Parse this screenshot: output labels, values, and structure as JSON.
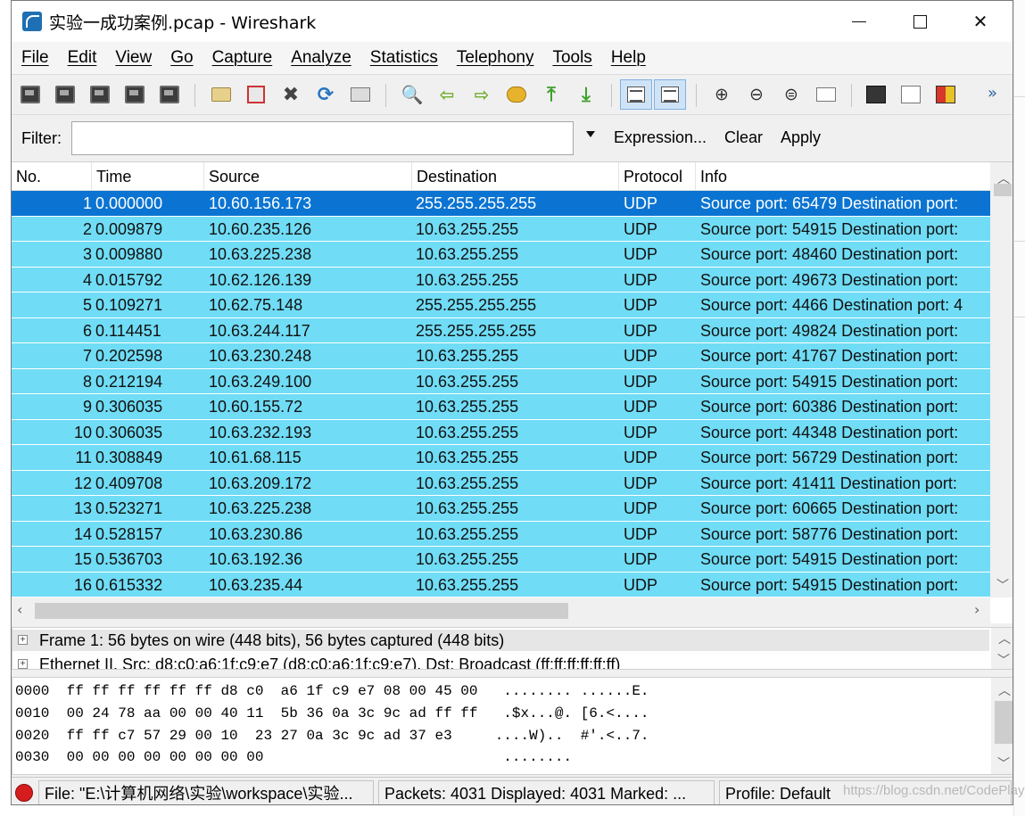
{
  "window": {
    "title": "实验一成功案例.pcap - Wireshark",
    "controls": {
      "minimize": "",
      "maximize": "",
      "close": "✕"
    }
  },
  "menu": [
    "File",
    "Edit",
    "View",
    "Go",
    "Capture",
    "Analyze",
    "Statistics",
    "Telephony",
    "Tools",
    "Help"
  ],
  "filter": {
    "label": "Filter:",
    "value": "",
    "expression": "Expression...",
    "clear": "Clear",
    "apply": "Apply"
  },
  "columns": [
    "No.",
    "Time",
    "Source",
    "Destination",
    "Protocol",
    "Info"
  ],
  "packets": [
    {
      "no": "1",
      "time": "0.000000",
      "src": "10.60.156.173",
      "dst": "255.255.255.255",
      "proto": "UDP",
      "info": "Source port: 65479  Destination port:"
    },
    {
      "no": "2",
      "time": "0.009879",
      "src": "10.60.235.126",
      "dst": "10.63.255.255",
      "proto": "UDP",
      "info": "Source port: 54915  Destination port:"
    },
    {
      "no": "3",
      "time": "0.009880",
      "src": "10.63.225.238",
      "dst": "10.63.255.255",
      "proto": "UDP",
      "info": "Source port: 48460  Destination port:"
    },
    {
      "no": "4",
      "time": "0.015792",
      "src": "10.62.126.139",
      "dst": "10.63.255.255",
      "proto": "UDP",
      "info": "Source port: 49673  Destination port:"
    },
    {
      "no": "5",
      "time": "0.109271",
      "src": "10.62.75.148",
      "dst": "255.255.255.255",
      "proto": "UDP",
      "info": "Source port: 4466  Destination port: 4"
    },
    {
      "no": "6",
      "time": "0.114451",
      "src": "10.63.244.117",
      "dst": "255.255.255.255",
      "proto": "UDP",
      "info": "Source port: 49824  Destination port:"
    },
    {
      "no": "7",
      "time": "0.202598",
      "src": "10.63.230.248",
      "dst": "10.63.255.255",
      "proto": "UDP",
      "info": "Source port: 41767  Destination port:"
    },
    {
      "no": "8",
      "time": "0.212194",
      "src": "10.63.249.100",
      "dst": "10.63.255.255",
      "proto": "UDP",
      "info": "Source port: 54915  Destination port:"
    },
    {
      "no": "9",
      "time": "0.306035",
      "src": "10.60.155.72",
      "dst": "10.63.255.255",
      "proto": "UDP",
      "info": "Source port: 60386  Destination port:"
    },
    {
      "no": "10",
      "time": "0.306035",
      "src": "10.63.232.193",
      "dst": "10.63.255.255",
      "proto": "UDP",
      "info": "Source port: 44348  Destination port:"
    },
    {
      "no": "11",
      "time": "0.308849",
      "src": "10.61.68.115",
      "dst": "10.63.255.255",
      "proto": "UDP",
      "info": "Source port: 56729  Destination port:"
    },
    {
      "no": "12",
      "time": "0.409708",
      "src": "10.63.209.172",
      "dst": "10.63.255.255",
      "proto": "UDP",
      "info": "Source port: 41411  Destination port:"
    },
    {
      "no": "13",
      "time": "0.523271",
      "src": "10.63.225.238",
      "dst": "10.63.255.255",
      "proto": "UDP",
      "info": "Source port: 60665  Destination port:"
    },
    {
      "no": "14",
      "time": "0.528157",
      "src": "10.63.230.86",
      "dst": "10.63.255.255",
      "proto": "UDP",
      "info": "Source port: 58776  Destination port:"
    },
    {
      "no": "15",
      "time": "0.536703",
      "src": "10.63.192.36",
      "dst": "10.63.255.255",
      "proto": "UDP",
      "info": "Source port: 54915  Destination port:"
    },
    {
      "no": "16",
      "time": "0.615332",
      "src": "10.63.235.44",
      "dst": "10.63.255.255",
      "proto": "UDP",
      "info": "Source port: 54915  Destination port:"
    }
  ],
  "selected_packet": "1",
  "details": [
    "Frame 1: 56 bytes on wire (448 bits), 56 bytes captured (448 bits)",
    "Ethernet II, Src: d8:c0:a6:1f:c9:e7 (d8:c0:a6:1f:c9:e7), Dst: Broadcast (ff:ff:ff:ff:ff:ff)"
  ],
  "bytes": [
    "0000  ff ff ff ff ff ff d8 c0  a6 1f c9 e7 08 00 45 00   ........ ......E.",
    "0010  00 24 78 aa 00 00 40 11  5b 36 0a 3c 9c ad ff ff   .$x...@. [6.<....",
    "0020  ff ff c7 57 29 00 10  23 27 0a 3c 9c ad 37 e3     ....W)..  #'.<..7.",
    "0030  00 00 00 00 00 00 00 00                            ........"
  ],
  "status": {
    "file": "File: \"E:\\计算机网络\\实验\\workspace\\实验...",
    "packets": "Packets: 4031 Displayed: 4031 Marked: ...",
    "profile": "Profile: Default"
  },
  "watermark": "https://blog.csdn.net/CodePlayMe",
  "colors": {
    "row_bg": "#70dcf5",
    "selected_bg": "#0b74d2",
    "status_led": "#d51d1d"
  }
}
